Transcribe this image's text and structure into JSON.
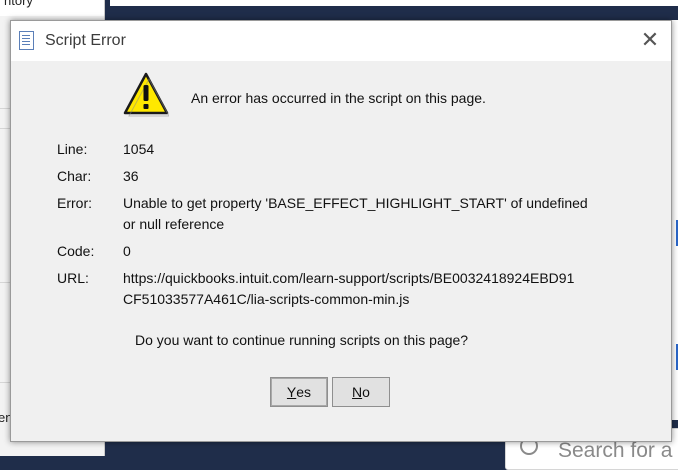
{
  "background": {
    "left_top_text": "ntory",
    "left_bottom_text": "en",
    "search_placeholder": "Search for a"
  },
  "dialog": {
    "title": "Script Error",
    "close_glyph": "✕",
    "message": "An error has occurred in the script on this page.",
    "fields": {
      "line_label": "Line:",
      "line_value": "1054",
      "char_label": "Char:",
      "char_value": "36",
      "error_label": "Error:",
      "error_value": "Unable to get property 'BASE_EFFECT_HIGHLIGHT_START' of undefined or null reference",
      "code_label": "Code:",
      "code_value": "0",
      "url_label": "URL:",
      "url_value": "https://quickbooks.intuit.com/learn-support/scripts/BE0032418924EBD91CF51033577A461C/lia-scripts-common-min.js"
    },
    "question": "Do you want to continue running scripts on this page?",
    "buttons": {
      "yes_mnemonic": "Y",
      "yes_rest": "es",
      "no_mnemonic": "N",
      "no_rest": "o"
    },
    "icons": {
      "title": "script-page-icon",
      "warning": "warning-triangle-icon",
      "close": "close-icon"
    },
    "colors": {
      "warning_fill": "#ffe800",
      "dialog_bg": "#f0f0f0"
    }
  }
}
